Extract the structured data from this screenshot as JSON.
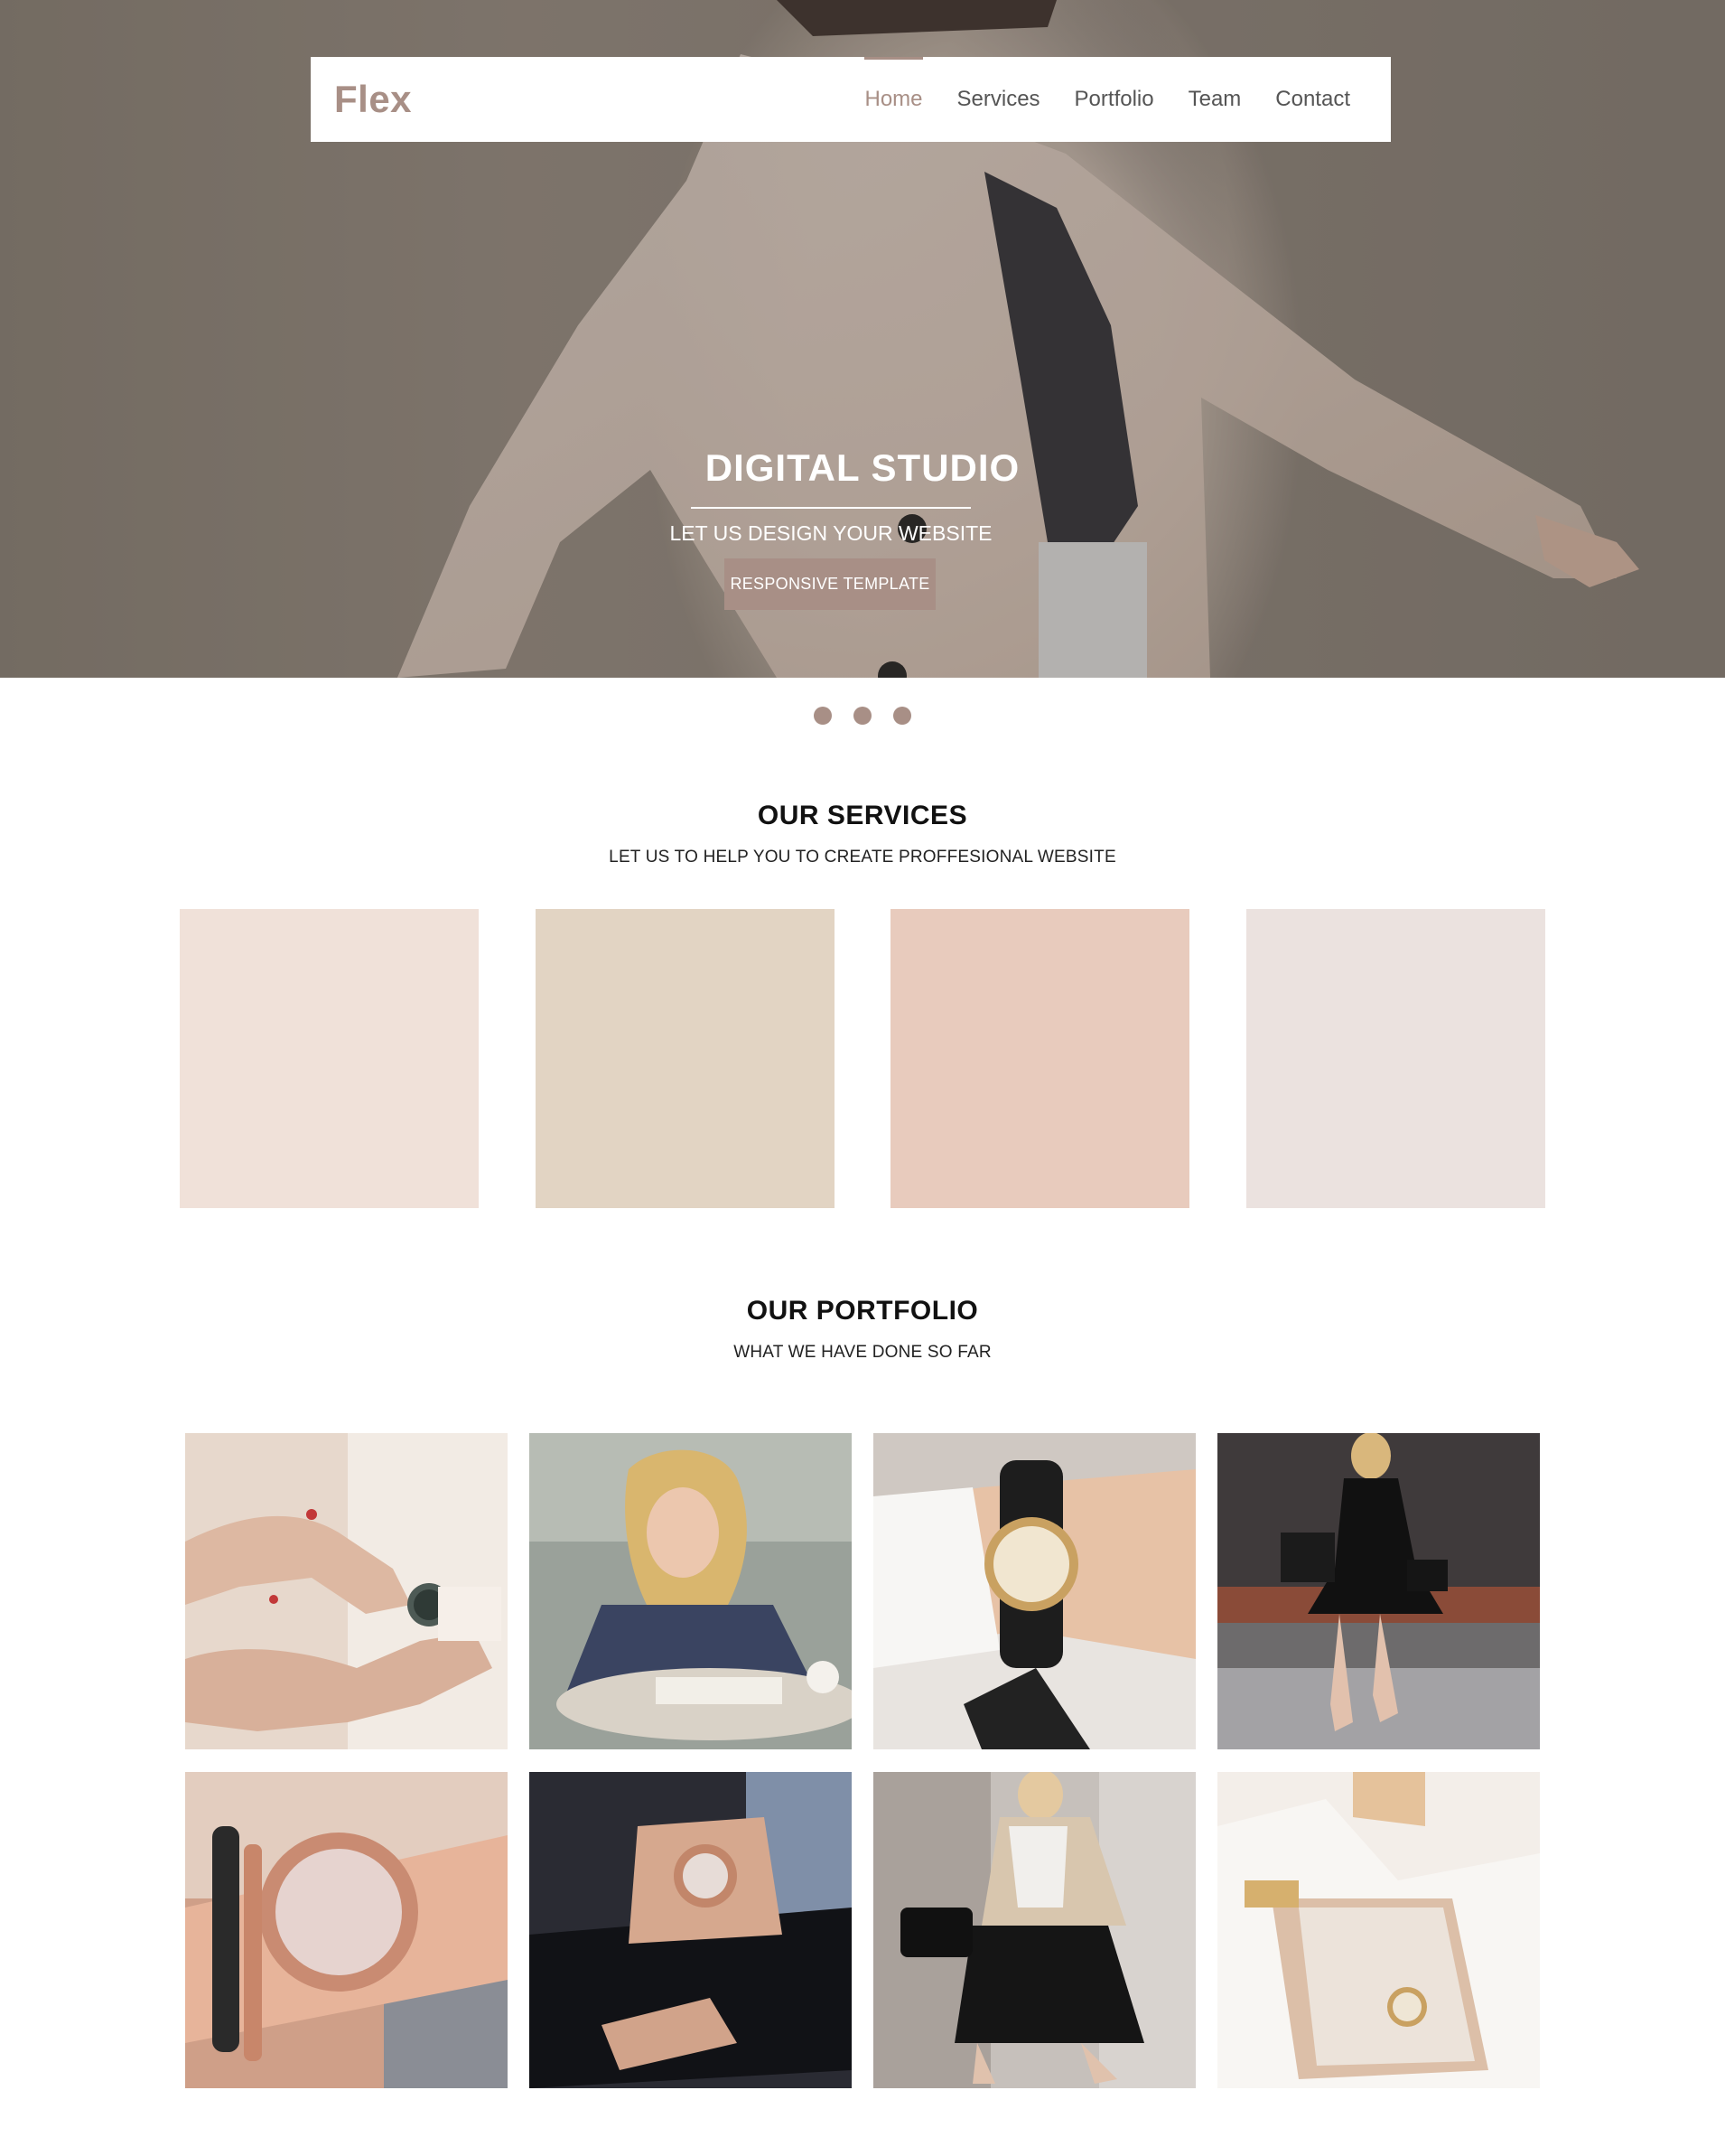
{
  "brand": "Flex",
  "nav": {
    "items": [
      "Home",
      "Services",
      "Portfolio",
      "Team",
      "Contact"
    ],
    "active": "Home"
  },
  "hero": {
    "title": "DIGITAL STUDIO",
    "subtitle": "LET US DESIGN YOUR WEBSITE",
    "button_label": "RESPONSIVE TEMPLATE"
  },
  "slider": {
    "slides": 3
  },
  "services": {
    "title": "OUR SERVICES",
    "subtitle": "LET US TO HELP YOU TO CREATE PROFFESIONAL WEBSITE",
    "card_colors": [
      "#f0e1d9",
      "#e2d4c3",
      "#e8cbbd",
      "#ebe2df"
    ]
  },
  "portfolio": {
    "title": "OUR PORTFOLIO",
    "subtitle": "WHAT WE HAVE DONE SO FAR"
  },
  "colors": {
    "accent": "#a88f86"
  }
}
